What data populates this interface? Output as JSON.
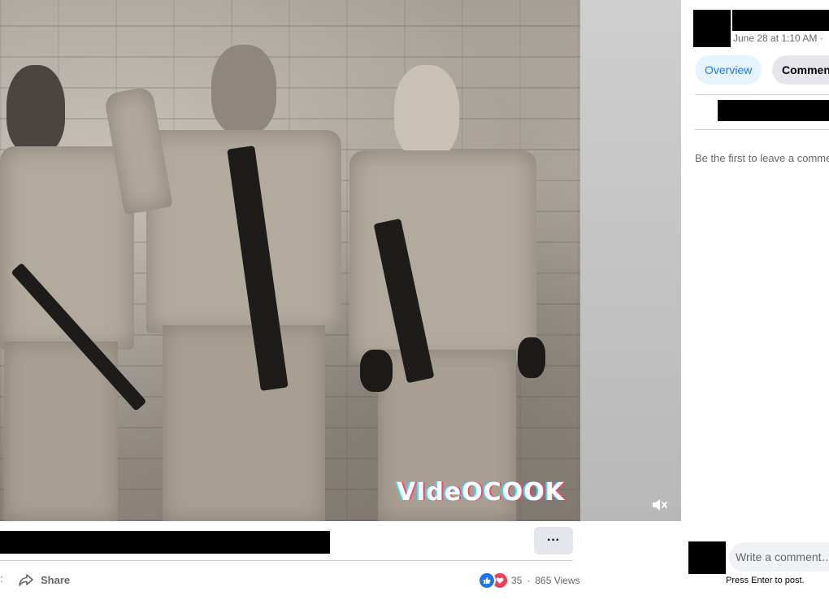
{
  "video": {
    "watermark": "VIdeOCOOK",
    "mute_icon": "speaker-muted-icon"
  },
  "post_actions": {
    "more_label": "···",
    "share_label": "Share",
    "left_edge_glyph": ":",
    "reactions": [
      "like-icon",
      "love-icon"
    ],
    "reaction_count": "35",
    "separator": "·",
    "views": "865 Views"
  },
  "panel": {
    "timestamp": "June 28 at 1:10 AM ·",
    "tabs": [
      {
        "label": "Overview",
        "active": true
      },
      {
        "label": "Comments",
        "active": false
      }
    ],
    "empty_comments": "Be the first to leave a comment.",
    "comment_placeholder": "Write a comment…",
    "enter_hint": "Press Enter to post."
  },
  "colors": {
    "accent": "#1877f2",
    "love": "#f33e58",
    "muted_text": "#65676b",
    "button_bg": "#e4e6eb"
  }
}
